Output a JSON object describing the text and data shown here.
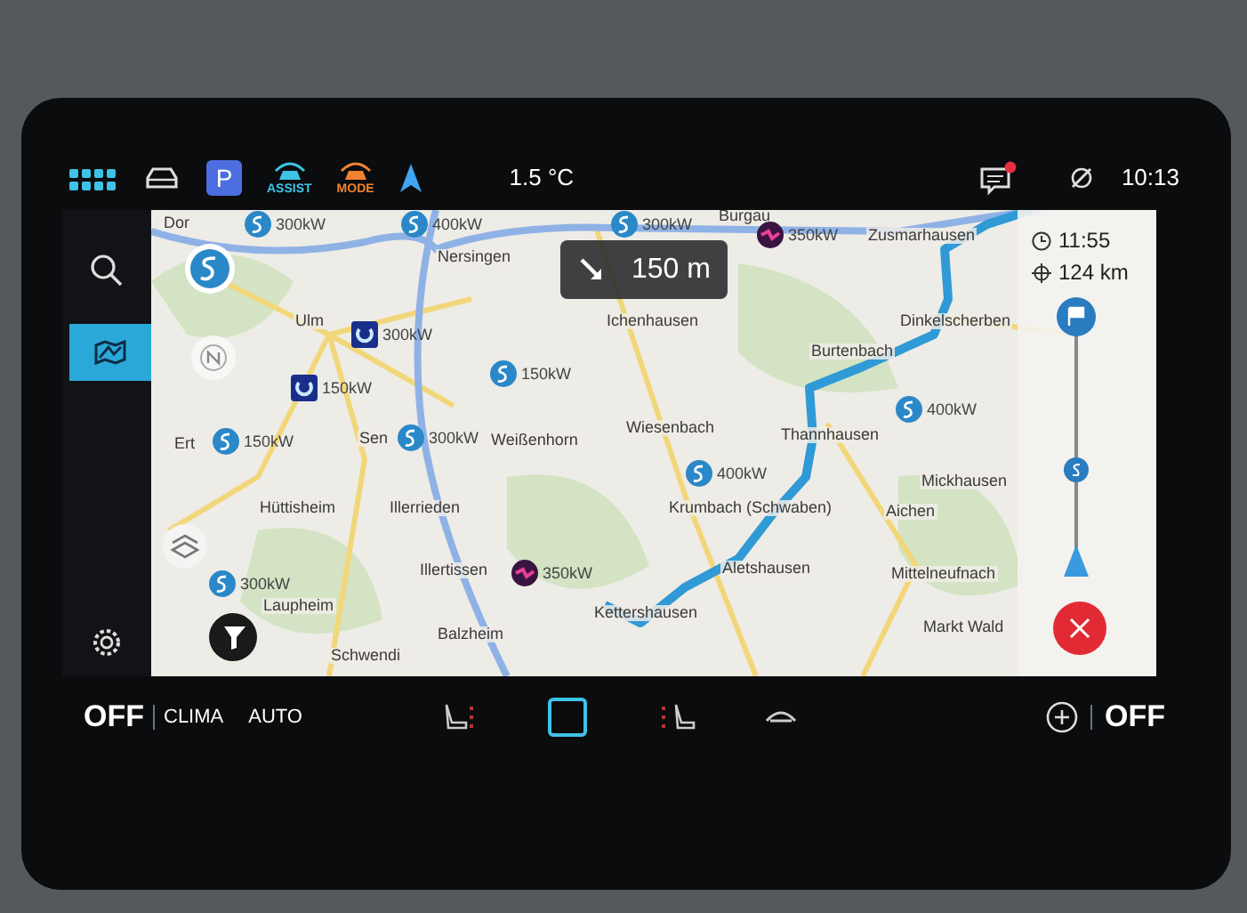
{
  "top_bar": {
    "quick_buttons": [
      {
        "kind": "parking",
        "label": "P"
      },
      {
        "kind": "assist",
        "label": "ASSIST"
      },
      {
        "kind": "mode",
        "label": "MODE"
      }
    ],
    "temperature": "1.5 °C",
    "notification_unread": true,
    "time": "10:13"
  },
  "sidebar": {
    "items": [
      {
        "kind": "search",
        "selected": false
      },
      {
        "kind": "map-view",
        "selected": true
      }
    ]
  },
  "map": {
    "turn_hint": {
      "distance": "150 m"
    },
    "route_info": {
      "arrival": "11:55",
      "distance": "124 km"
    },
    "places": [
      {
        "name": "Dor"
      },
      {
        "name": "Burgau"
      },
      {
        "name": "Zusmarhausen"
      },
      {
        "name": "Nersingen"
      },
      {
        "name": "Ulm"
      },
      {
        "name": "Ichenhausen"
      },
      {
        "name": "Dinkelscherben"
      },
      {
        "name": "Burtenbach"
      },
      {
        "name": "Wiesenbach"
      },
      {
        "name": "Thannhausen"
      },
      {
        "name": "Ert"
      },
      {
        "name": "Sen"
      },
      {
        "name": "Weißenhorn"
      },
      {
        "name": "Mickhausen"
      },
      {
        "name": "Hüttisheim"
      },
      {
        "name": "Illerrieden"
      },
      {
        "name": "Krumbach (Schwaben)"
      },
      {
        "name": "Aichen"
      },
      {
        "name": "Illertissen"
      },
      {
        "name": "Aletshausen"
      },
      {
        "name": "Mittelneufnach"
      },
      {
        "name": "Laupheim"
      },
      {
        "name": "Kettershausen"
      },
      {
        "name": "Markt Wald"
      },
      {
        "name": "Balzheim"
      },
      {
        "name": "Schwendi"
      }
    ],
    "chargers": [
      {
        "kind": "station",
        "power": "300kW"
      },
      {
        "kind": "station",
        "power": "400kW"
      },
      {
        "kind": "station",
        "power": "300kW"
      },
      {
        "kind": "ionity",
        "power": "350kW"
      },
      {
        "kind": "operator",
        "power": "300kW"
      },
      {
        "kind": "operator",
        "power": "150kW"
      },
      {
        "kind": "station",
        "power": "150kW"
      },
      {
        "kind": "station",
        "power": "150kW"
      },
      {
        "kind": "station",
        "power": "300kW"
      },
      {
        "kind": "station",
        "power": "400kW"
      },
      {
        "kind": "station",
        "power": "400kW"
      },
      {
        "kind": "station",
        "power": "300kW"
      },
      {
        "kind": "ionity",
        "power": "350kW"
      }
    ]
  },
  "climate": {
    "left_status": "OFF",
    "clima": "CLIMA",
    "auto": "AUTO",
    "right_status": "OFF"
  }
}
